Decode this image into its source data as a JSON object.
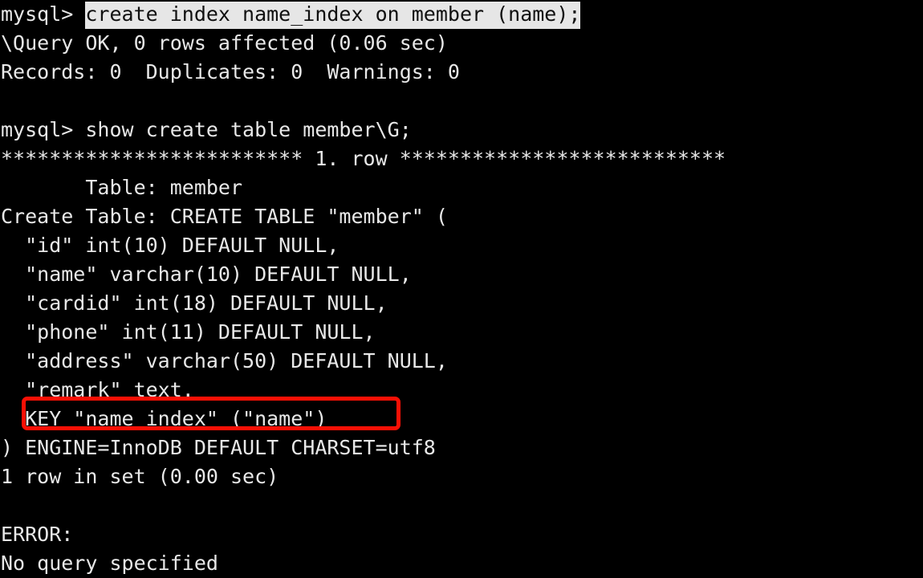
{
  "terminal": {
    "title": "mysql client session",
    "background_color": "#000000",
    "foreground_color": "#e8e8e8",
    "selection_background": "#e6e6e6",
    "selection_foreground": "#101010",
    "annotation_color": "#fb1005",
    "font_size_px": 25,
    "line_height_px": 36,
    "columns": 64,
    "rows": 20
  },
  "lines": [
    {
      "id": "line-1",
      "type": "prompt",
      "prompt": "mysql> ",
      "selected": "create index name_index on member (name);",
      "text": ""
    },
    {
      "id": "line-2",
      "type": "output",
      "text": "\\Query OK, 0 rows affected (0.06 sec)"
    },
    {
      "id": "line-3",
      "type": "output",
      "text": "Records: 0  Duplicates: 0  Warnings: 0"
    },
    {
      "id": "line-4",
      "type": "blank",
      "text": ""
    },
    {
      "id": "line-5",
      "type": "prompt-plain",
      "text": "mysql> show create table member\\G;"
    },
    {
      "id": "line-6",
      "type": "output",
      "text": "************************* 1. row ***************************"
    },
    {
      "id": "line-7",
      "type": "output",
      "text": "       Table: member"
    },
    {
      "id": "line-8",
      "type": "output",
      "text": "Create Table: CREATE TABLE \"member\" ("
    },
    {
      "id": "line-9",
      "type": "output",
      "text": "  \"id\" int(10) DEFAULT NULL,"
    },
    {
      "id": "line-10",
      "type": "output",
      "text": "  \"name\" varchar(10) DEFAULT NULL,"
    },
    {
      "id": "line-11",
      "type": "output",
      "text": "  \"cardid\" int(18) DEFAULT NULL,"
    },
    {
      "id": "line-12",
      "type": "output",
      "text": "  \"phone\" int(11) DEFAULT NULL,"
    },
    {
      "id": "line-13",
      "type": "output",
      "text": "  \"address\" varchar(50) DEFAULT NULL,"
    },
    {
      "id": "line-14",
      "type": "output",
      "text": "  \"remark\" text."
    },
    {
      "id": "line-15",
      "type": "output-highlighted",
      "text": "  KEY \"name_index\" (\"name\")"
    },
    {
      "id": "line-16",
      "type": "output",
      "text": ") ENGINE=InnoDB DEFAULT CHARSET=utf8"
    },
    {
      "id": "line-17",
      "type": "output",
      "text": "1 row in set (0.00 sec)"
    },
    {
      "id": "line-18",
      "type": "blank",
      "text": ""
    },
    {
      "id": "line-19",
      "type": "output",
      "text": "ERROR:"
    },
    {
      "id": "line-20",
      "type": "output",
      "text": "No query specified"
    }
  ],
  "annotation": {
    "name": "red-highlight-box",
    "target_line": "line-15",
    "target_text": "KEY \"name_index\" (\"name\")",
    "color": "#fb1005"
  }
}
